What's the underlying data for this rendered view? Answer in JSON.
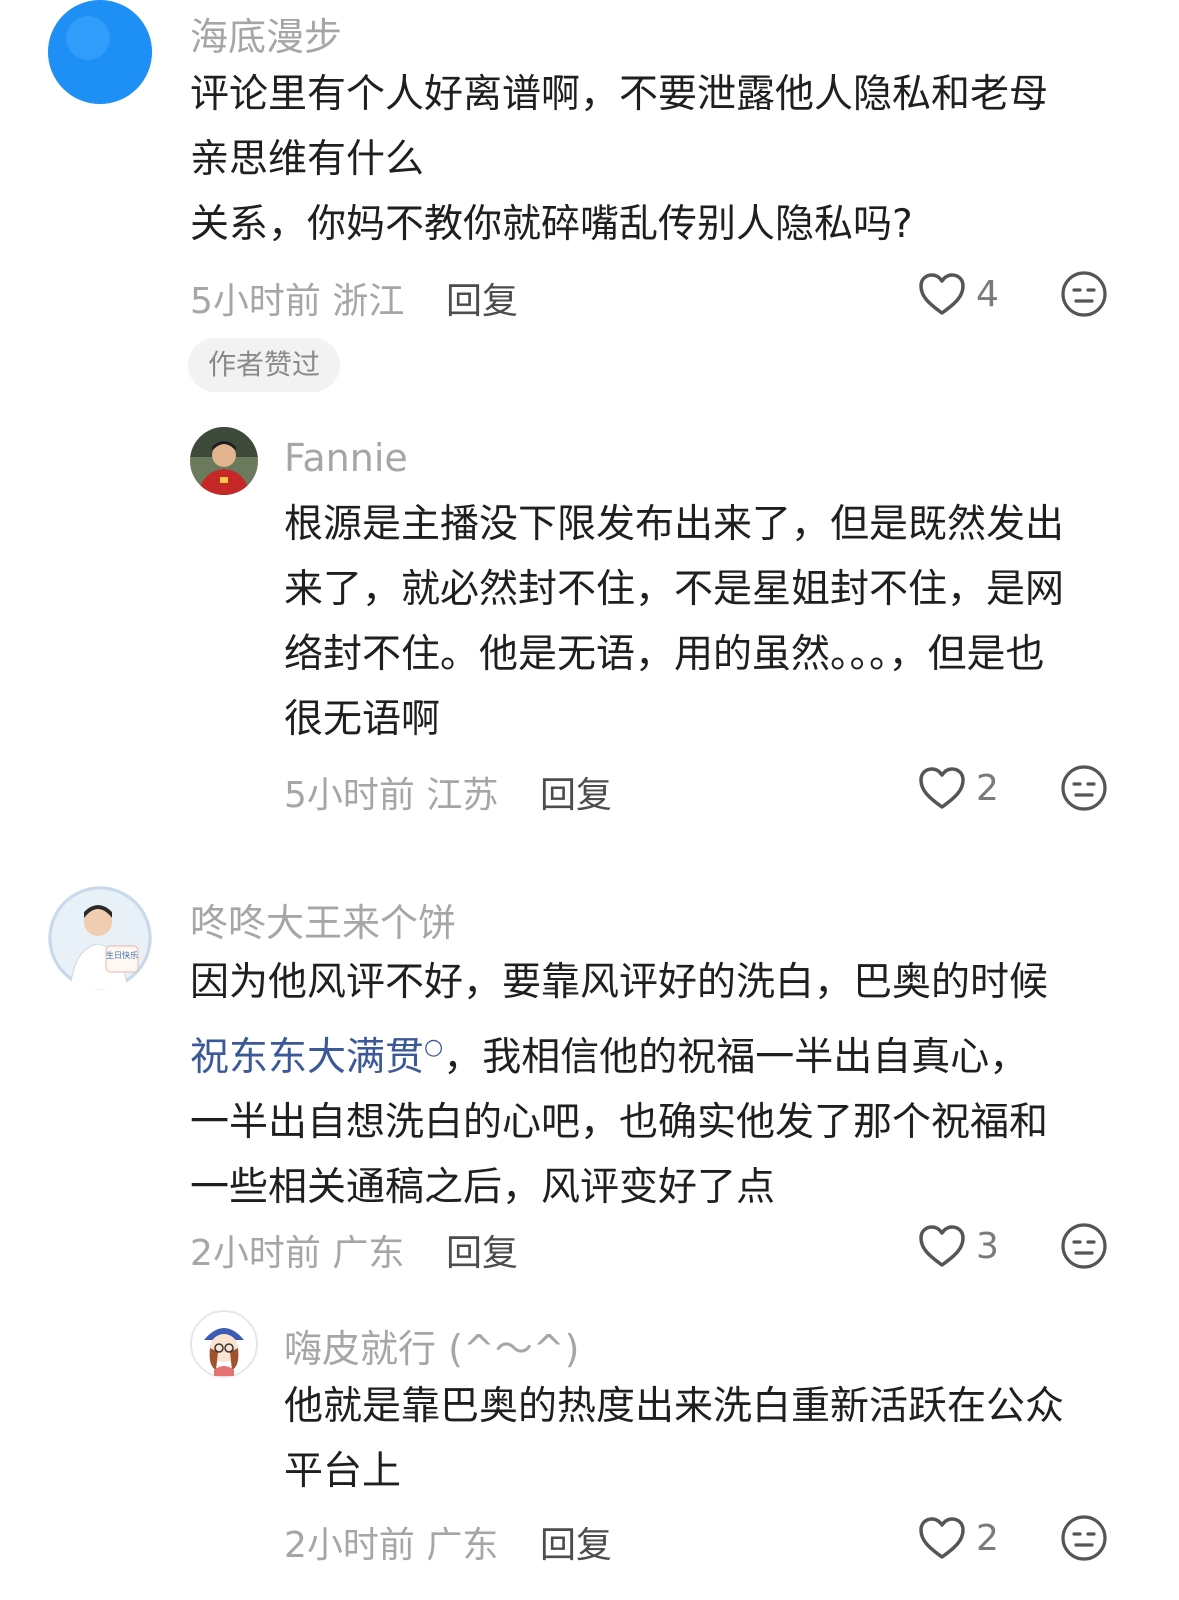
{
  "comments": [
    {
      "username": "海底漫步",
      "lines": [
        "评论里有个人好离谱啊，不要泄露他人隐私和老母",
        "亲思维有什么",
        "关系，你妈不教你就碎嘴乱传别人隐私吗?"
      ],
      "time": "5小时前",
      "location": "浙江",
      "reply_label": "回复",
      "likes": "4",
      "badge": "作者赞过",
      "avatar_color": "#1e90f5",
      "reply": {
        "username": "Fannie",
        "lines": [
          "根源是主播没下限发布出来了，但是既然发出",
          "来了，就必然封不住，不是星姐封不住，是网",
          "络封不住。他是无语，用的虽然。。。，但是也",
          "很无语啊"
        ],
        "time": "5小时前",
        "location": "江苏",
        "reply_label": "回复",
        "likes": "2"
      }
    },
    {
      "username": "咚咚大王来个饼",
      "line1": "因为他风评不好，要靠风评好的洗白，巴奥的时候",
      "link_text": "祝东东大满贯",
      "line2_rest": "，我相信他的祝福一半出自真心，",
      "lines_after": [
        "一半出自想洗白的心吧，也确实他发了那个祝福和",
        "一些相关通稿之后，风评变好了点"
      ],
      "time": "2小时前",
      "location": "广东",
      "reply_label": "回复",
      "likes": "3",
      "avatar_text": "生日快乐",
      "reply": {
        "username": "嗨皮就行 (^～^)",
        "lines": [
          "他就是靠巴奥的热度出来洗白重新活跃在公众",
          "平台上"
        ],
        "time": "2小时前",
        "location": "广东",
        "reply_label": "回复",
        "likes": "2"
      }
    }
  ]
}
